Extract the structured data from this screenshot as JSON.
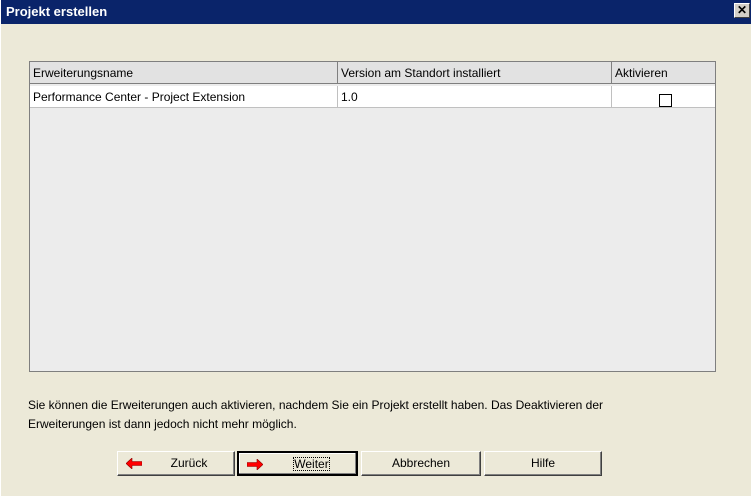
{
  "window": {
    "title": "Projekt erstellen",
    "close_glyph": "✕"
  },
  "table": {
    "columns": [
      "Erweiterungsname",
      "Version am Standort installiert",
      "Aktivieren"
    ],
    "rows": [
      {
        "name": "Performance Center - Project Extension",
        "version": "1.0",
        "activate": false
      }
    ]
  },
  "info": {
    "line1": "Sie können die Erweiterungen auch aktivieren, nachdem Sie ein Projekt erstellt haben. Das Deaktivieren der",
    "line2": "Erweiterungen ist dann jedoch nicht mehr möglich."
  },
  "buttons": {
    "back": "Zurück",
    "next": "Weiter",
    "cancel": "Abbrechen",
    "help": "Hilfe"
  },
  "colors": {
    "titlebar": "#0a246a",
    "arrow_red": "#ff0000"
  },
  "icons": {
    "back": "arrow-left-icon",
    "next": "arrow-right-icon",
    "close": "close-icon"
  }
}
